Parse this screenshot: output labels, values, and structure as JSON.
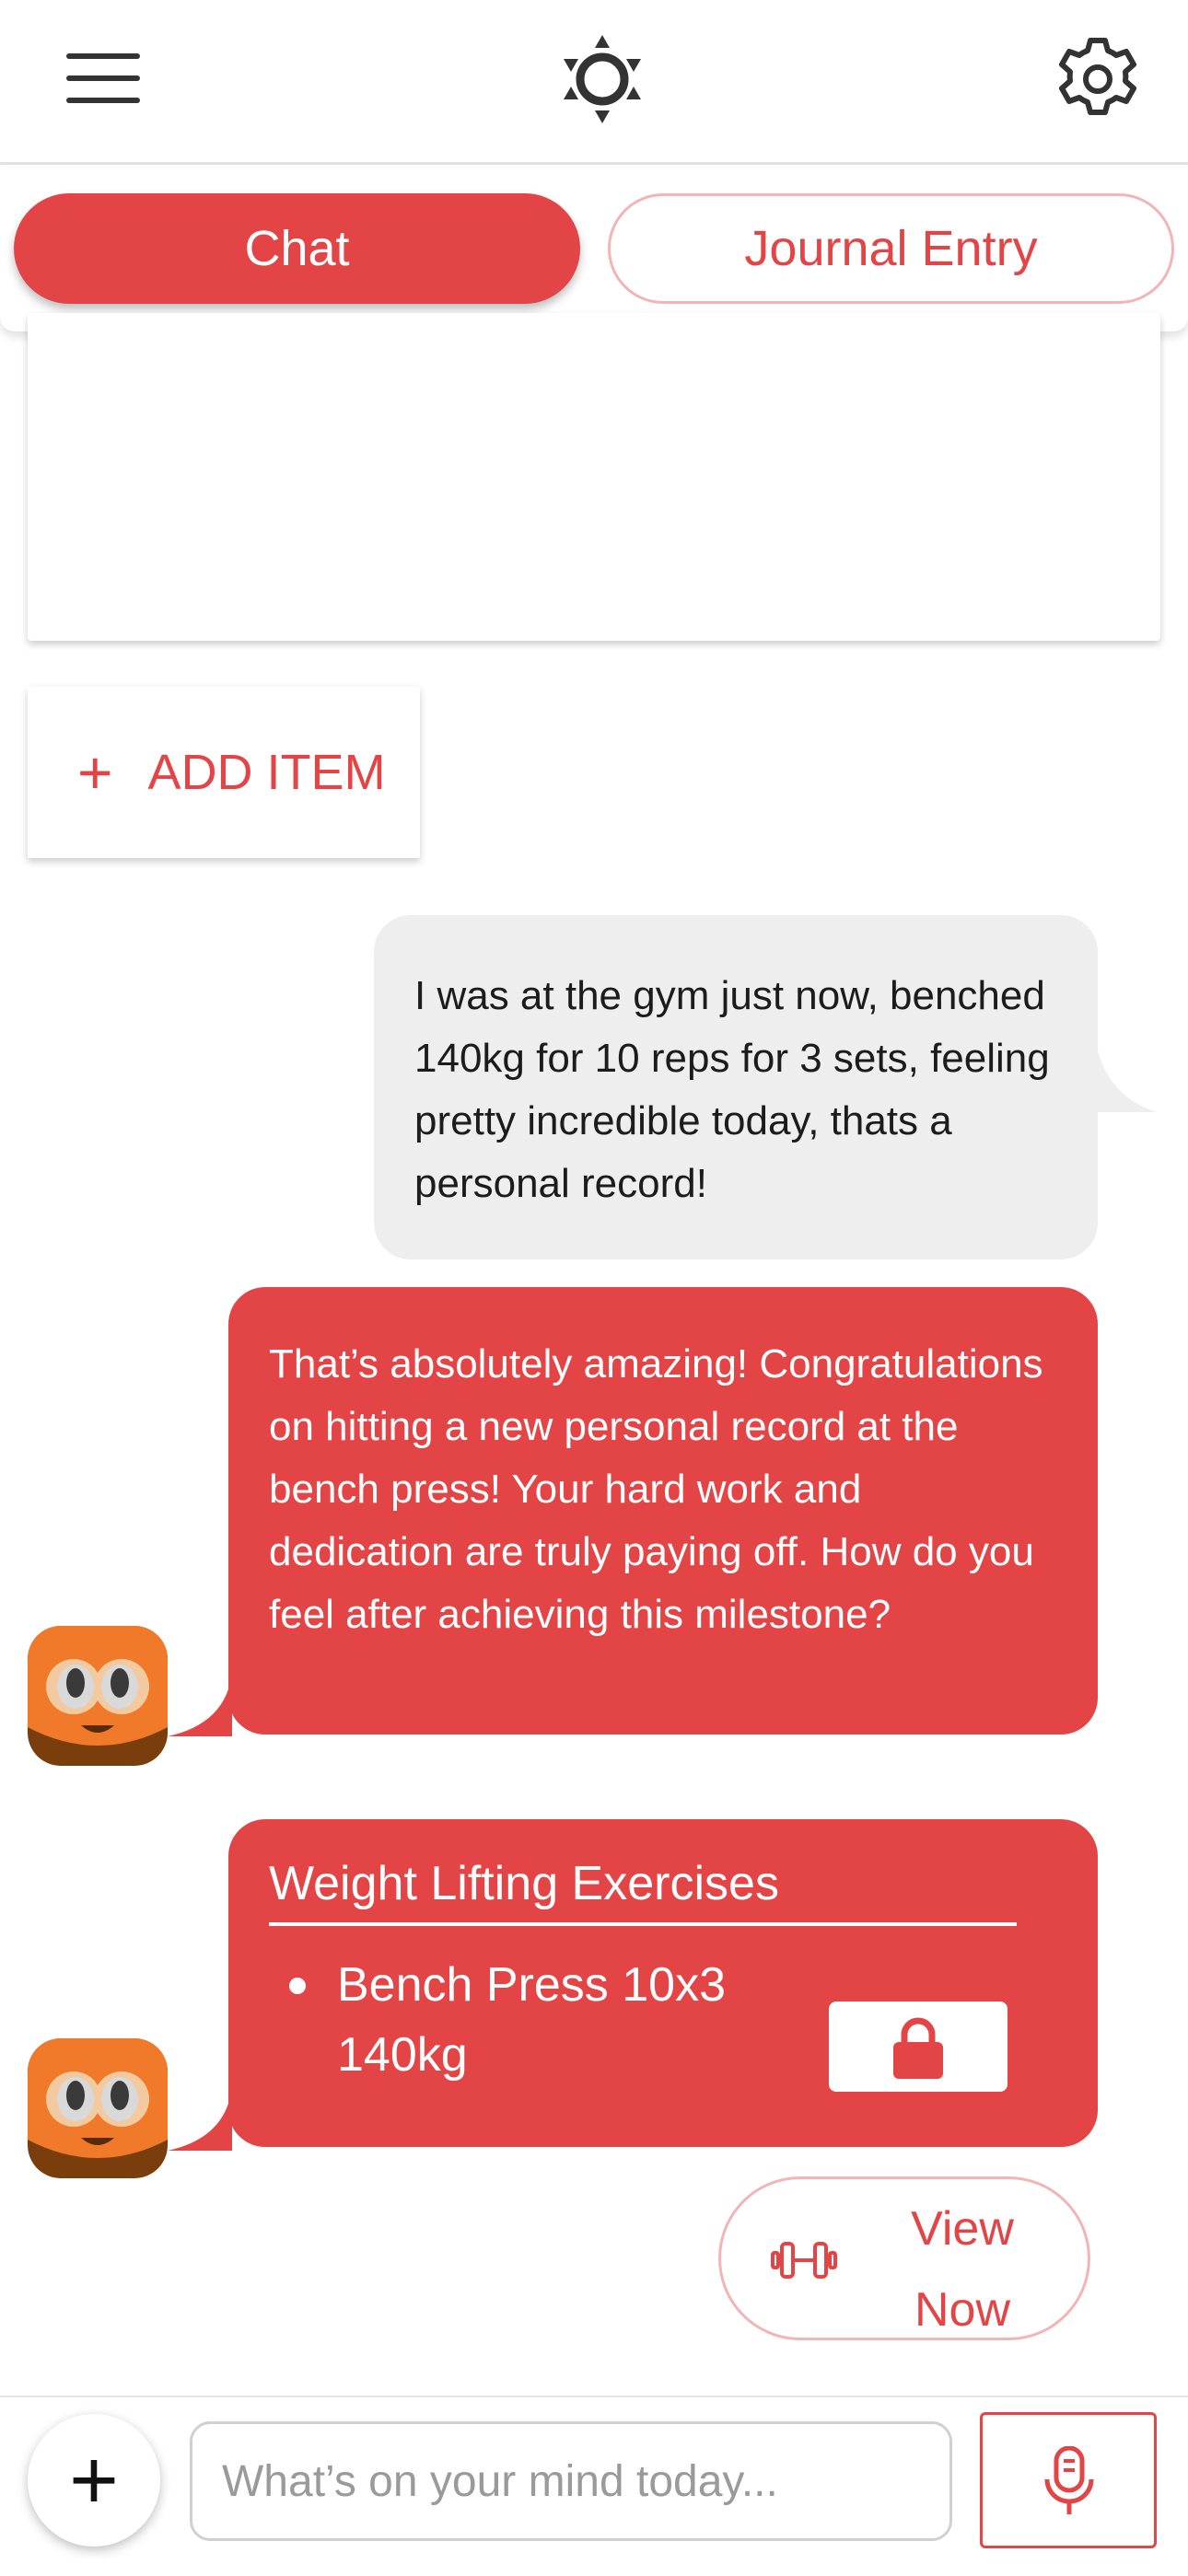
{
  "header": {
    "menu_icon": "hamburger-menu-icon",
    "center_icon": "sun-brightness-icon",
    "settings_icon": "gear-icon"
  },
  "tabs": [
    {
      "label": "Chat",
      "active": true
    },
    {
      "label": "Journal Entry",
      "active": false
    }
  ],
  "add_item": {
    "label": "ADD ITEM",
    "icon": "plus-icon"
  },
  "messages": {
    "user_1": "I was at the gym just now, benched 140kg for 10 reps for 3 sets, feeling pretty incredible today, thats a personal record!",
    "bot_1": "That’s absolutely amazing! Congratulations on hitting a new personal record at the bench press! Your hard work and dedication are truly paying off. How do you feel after achieving this milestone?",
    "bot_2": {
      "title": "Weight Lifting Exercises",
      "items": [
        "Bench Press 10x3 140kg"
      ],
      "lock_icon": "lock-icon"
    }
  },
  "view_now": {
    "label": "View Now",
    "icon": "dumbbell-icon"
  },
  "composer": {
    "placeholder": "What’s on your mind today...",
    "value": "",
    "add_icon": "plus-icon",
    "mic_icon": "microphone-icon"
  },
  "colors": {
    "accent": "#e34547",
    "accent_light_border": "#f2b5b6",
    "user_bubble": "#efeeee",
    "avatar_orange": "#f07a2a"
  }
}
